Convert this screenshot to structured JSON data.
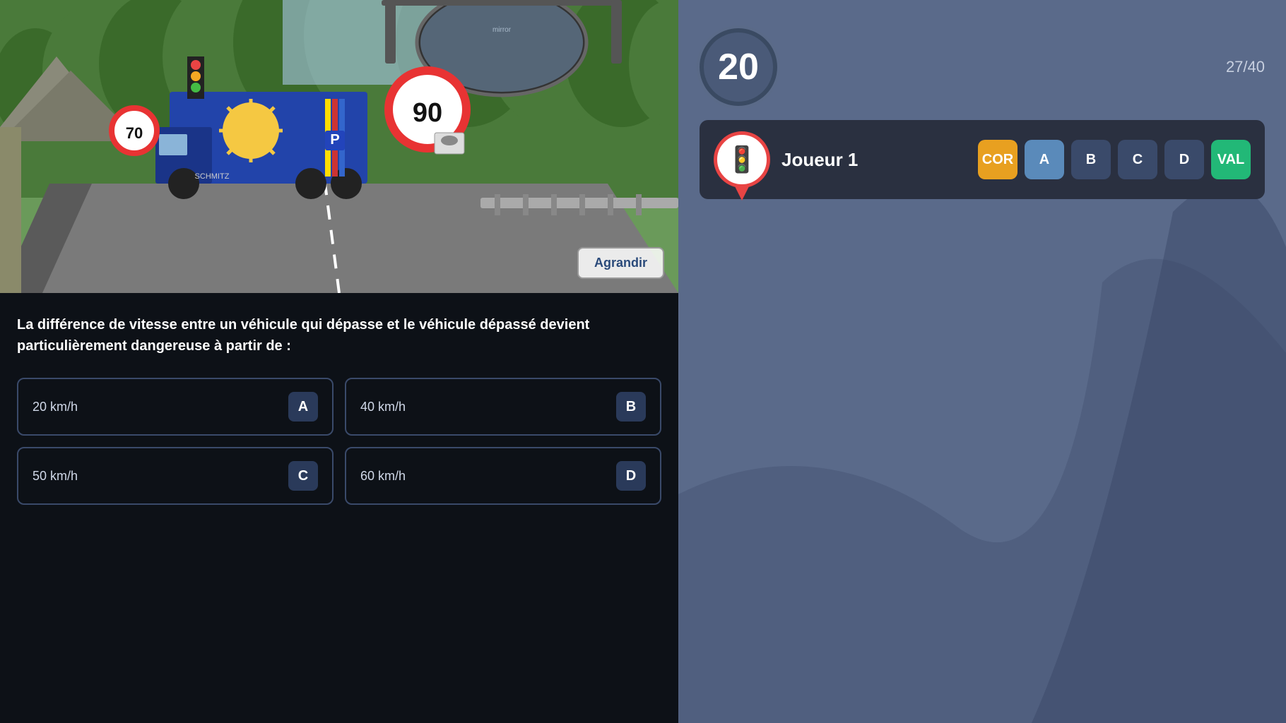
{
  "left": {
    "question": "La différence de vitesse entre un véhicule qui dépasse et le véhicule dépassé devient particulièrement dangereuse à partir de :",
    "agrandir_label": "Agrandir",
    "answers": [
      {
        "id": "a",
        "text": "20 km/h",
        "letter": "A"
      },
      {
        "id": "b",
        "text": "40 km/h",
        "letter": "B"
      },
      {
        "id": "c",
        "text": "50 km/h",
        "letter": "C"
      },
      {
        "id": "d",
        "text": "60 km/h",
        "letter": "D"
      }
    ]
  },
  "right": {
    "timer": "20",
    "progress": "27/40",
    "player_name": "Joueur 1",
    "avatar_icon": "🚦",
    "buttons": {
      "cor": "COR",
      "a": "A",
      "b": "B",
      "c": "C",
      "d": "D",
      "val": "VAL"
    }
  }
}
